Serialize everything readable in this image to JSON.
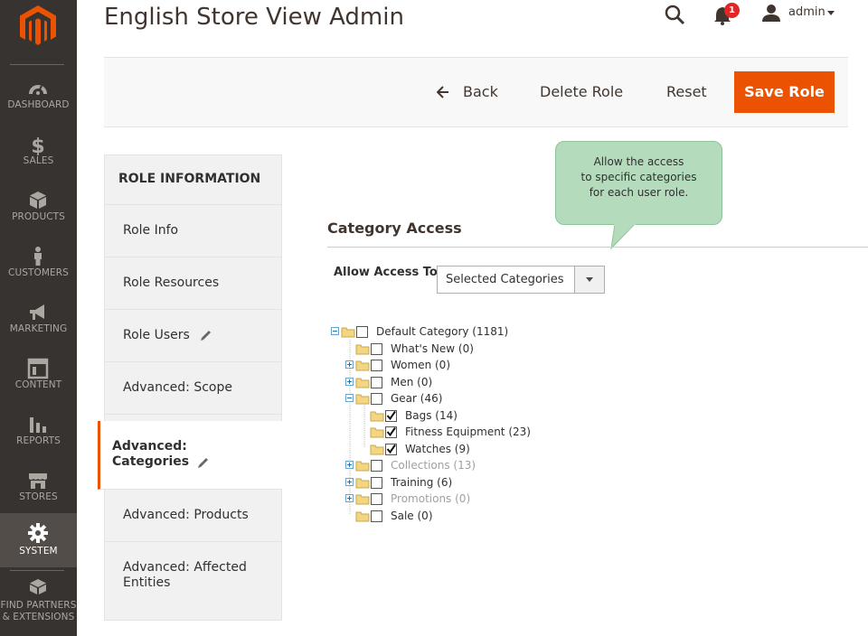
{
  "sidebar": {
    "logo": "magento-logo",
    "items": [
      {
        "label": "DASHBOARD",
        "icon": "dashboard-icon"
      },
      {
        "label": "SALES",
        "icon": "dollar-icon"
      },
      {
        "label": "PRODUCTS",
        "icon": "box-icon"
      },
      {
        "label": "CUSTOMERS",
        "icon": "person-icon"
      },
      {
        "label": "MARKETING",
        "icon": "megaphone-icon"
      },
      {
        "label": "CONTENT",
        "icon": "layout-icon"
      },
      {
        "label": "REPORTS",
        "icon": "bar-chart-icon"
      },
      {
        "label": "STORES",
        "icon": "storefront-icon"
      },
      {
        "label": "SYSTEM",
        "icon": "gear-icon",
        "active": true
      },
      {
        "label_line1": "FIND PARTNERS",
        "label_line2": "& EXTENSIONS",
        "icon": "partners-icon"
      }
    ]
  },
  "header": {
    "title": "English Store View Admin",
    "notifications_count": "1",
    "user": "admin"
  },
  "actions": {
    "back": "Back",
    "delete": "Delete Role",
    "reset": "Reset",
    "save": "Save Role"
  },
  "tabs": {
    "title": "ROLE INFORMATION",
    "items": [
      {
        "label": "Role Info"
      },
      {
        "label": "Role Resources"
      },
      {
        "label": "Role Users",
        "edited": true
      },
      {
        "label": "Advanced: Scope"
      },
      {
        "label": "Advanced: Categories",
        "active": true,
        "edited": true
      },
      {
        "label": "Advanced: Products"
      },
      {
        "label": "Advanced: Affected Entities"
      }
    ]
  },
  "tooltip": {
    "line1": "Allow the access",
    "line2": "to specific categories",
    "line3": "for each user role."
  },
  "category_access": {
    "title": "Category Access",
    "allow_label": "Allow Access To",
    "allow_value": "Selected Categories",
    "tree": [
      {
        "label": "Default Category (1181)",
        "checked": false,
        "expanded": true
      },
      {
        "label": "What's New (0)",
        "checked": false
      },
      {
        "label": "Women (0)",
        "checked": false,
        "expandable": true
      },
      {
        "label": "Men (0)",
        "checked": false,
        "expandable": true
      },
      {
        "label": "Gear (46)",
        "checked": false,
        "expanded": true
      },
      {
        "label": "Bags (14)",
        "checked": true
      },
      {
        "label": "Fitness Equipment (23)",
        "checked": true
      },
      {
        "label": "Watches (9)",
        "checked": true
      },
      {
        "label": "Collections (13)",
        "checked": false,
        "expandable": true,
        "disabled": true
      },
      {
        "label": "Training (6)",
        "checked": false,
        "expandable": true
      },
      {
        "label": "Promotions (0)",
        "checked": false,
        "expandable": true,
        "disabled": true
      },
      {
        "label": "Sale (0)",
        "checked": false
      }
    ]
  },
  "colors": {
    "accent": "#eb5202",
    "sidebar_bg": "#373330",
    "tooltip_bg": "#b4dbbc",
    "badge": "#e22626"
  }
}
